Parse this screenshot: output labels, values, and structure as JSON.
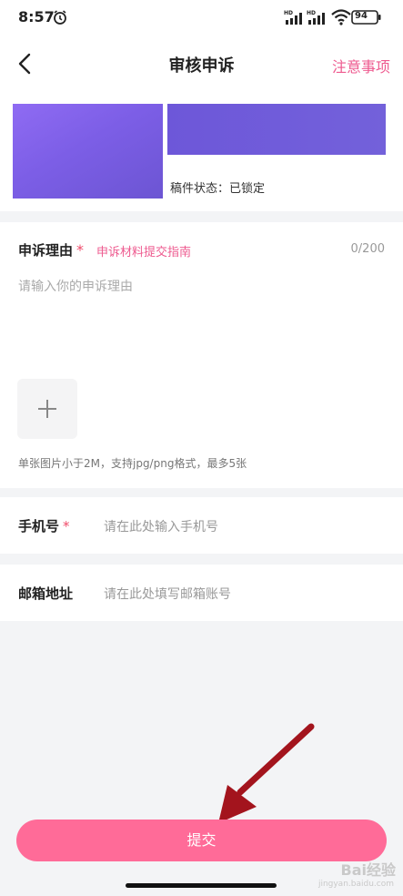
{
  "status_bar": {
    "time": "8:57",
    "battery": "94"
  },
  "nav": {
    "title": "审核申诉",
    "right_link": "注意事项"
  },
  "draft": {
    "status": "稿件状态：已锁定"
  },
  "reason": {
    "label": "申诉理由",
    "required_mark": "*",
    "guide_link": "申诉材料提交指南",
    "counter": "0/200",
    "placeholder": "请输入你的申诉理由",
    "upload_hint": "单张图片小于2M，支持jpg/png格式，最多5张"
  },
  "phone": {
    "label": "手机号",
    "required_mark": "*",
    "placeholder": "请在此处输入手机号"
  },
  "email": {
    "label": "邮箱地址",
    "placeholder": "请在此处填写邮箱账号"
  },
  "submit": {
    "label": "提交"
  },
  "watermark": {
    "line1": "Bai经验",
    "line2": "jingyan.baidu.com"
  },
  "colors": {
    "accent": "#ff6b98",
    "link": "#ee5a8f",
    "required": "#f04b6a"
  },
  "icons": [
    "alarm-icon",
    "signal-icon",
    "wifi-icon",
    "battery-icon",
    "back-arrow-icon",
    "plus-icon",
    "annotation-arrow"
  ]
}
